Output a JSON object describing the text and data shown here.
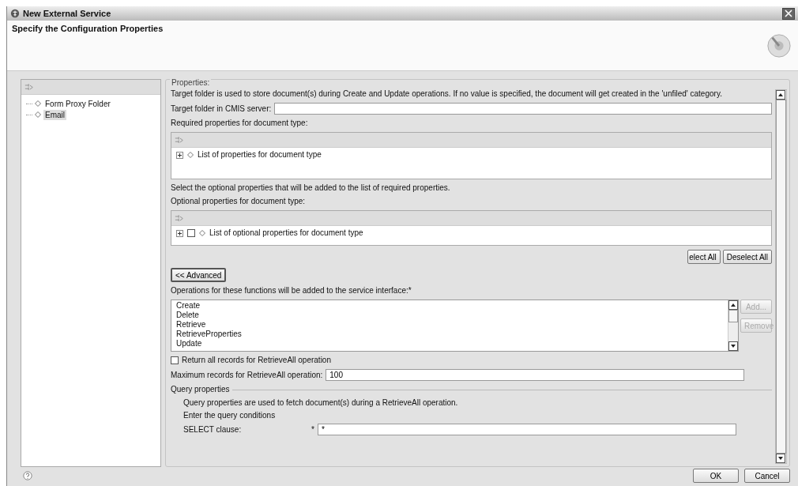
{
  "window": {
    "title": "New External Service"
  },
  "header": {
    "title": "Specify the Configuration Properties"
  },
  "tree": {
    "items": [
      {
        "label": "Form Proxy Folder",
        "selected": false
      },
      {
        "label": "Email",
        "selected": true
      }
    ]
  },
  "properties": {
    "legend": "Properties:",
    "description": "Target folder is used to store document(s) during Create and Update operations. If no value is specified, the document will get created in the 'unfiled' category.",
    "target_folder": {
      "label": "Target folder in CMIS server:"
    },
    "required": {
      "label": "Required properties for document type:",
      "items": [
        {
          "label": "List of properties for document type"
        }
      ]
    },
    "optional_hint": "Select the optional properties that will be added to the list of required properties.",
    "optional": {
      "label": "Optional properties for document type:",
      "items": [
        {
          "label": "List of optional properties for document type",
          "checked": false
        }
      ]
    },
    "select_buttons": [
      {
        "label": "elect All"
      },
      {
        "label": "Deselect All"
      }
    ],
    "advanced_button": "<< Advanced",
    "operations": {
      "label": "Operations for these functions will be added to the service interface:*",
      "items": [
        "Create",
        "Delete",
        "Retrieve",
        "RetrieveProperties",
        "Update"
      ],
      "buttons": [
        {
          "label": "Add...",
          "disabled": true
        },
        {
          "label": "Remove",
          "disabled": true
        }
      ]
    },
    "return_all": {
      "label": "Return all records for RetrieveAll operation",
      "checked": false
    },
    "max_records": {
      "label": "Maximum records for RetrieveAll operation:",
      "value": "100"
    },
    "query": {
      "legend": "Query properties",
      "description": "Query properties are used to fetch document(s) during a RetrieveAll operation.",
      "hint": "Enter the query conditions",
      "select_clause": {
        "label": "SELECT clause:",
        "required_mark": "*",
        "value": "*"
      }
    }
  },
  "footer": {
    "buttons": [
      "OK",
      "Cancel"
    ]
  }
}
